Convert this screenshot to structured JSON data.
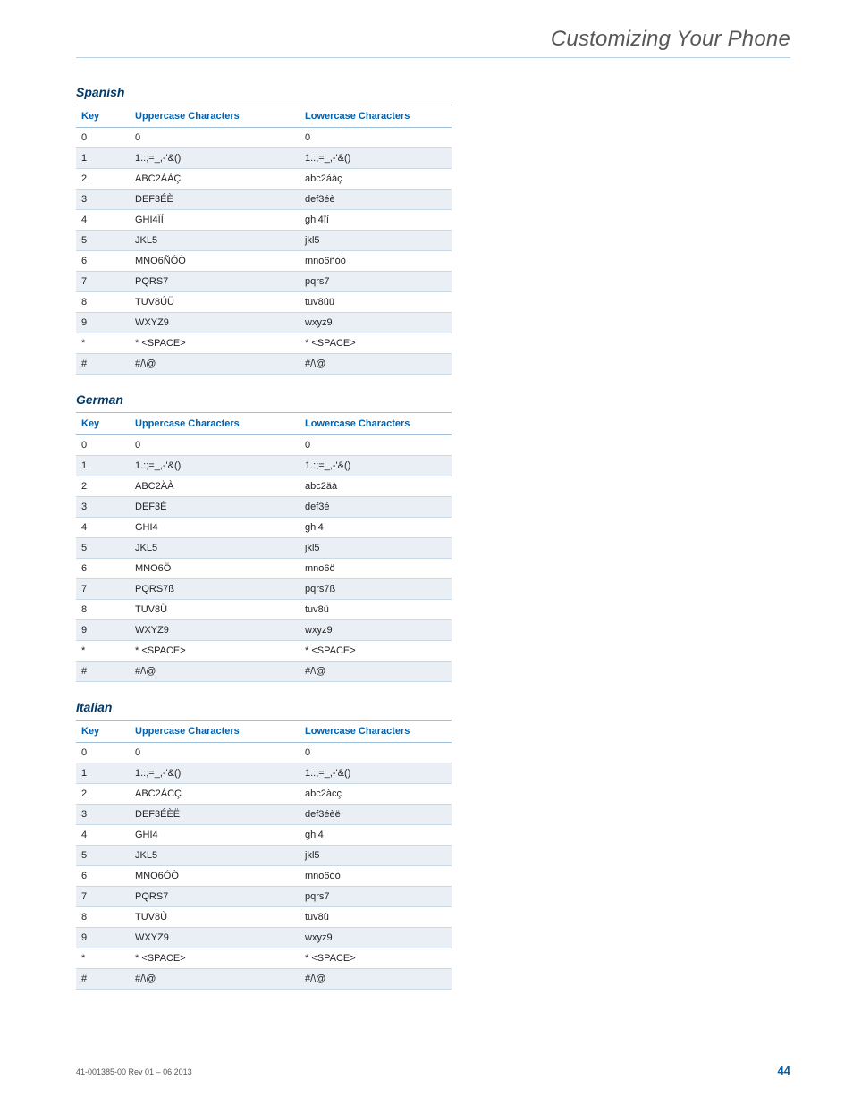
{
  "header": {
    "title": "Customizing Your Phone"
  },
  "columns": {
    "key": "Key",
    "upper": "Uppercase Characters",
    "lower": "Lowercase Characters"
  },
  "sections": [
    {
      "title": "Spanish",
      "rows": [
        {
          "key": "0",
          "upper": "0",
          "lower": "0"
        },
        {
          "key": "1",
          "upper": "1.:;=_,-'&()",
          "lower": "1.:;=_,-'&()"
        },
        {
          "key": "2",
          "upper": "ABC2ÁÀÇ",
          "lower": "abc2áàç"
        },
        {
          "key": "3",
          "upper": "DEF3ÉÈ",
          "lower": "def3éè"
        },
        {
          "key": "4",
          "upper": "GHI4ÏÍ",
          "lower": "ghi4ïí"
        },
        {
          "key": "5",
          "upper": "JKL5",
          "lower": "jkl5"
        },
        {
          "key": "6",
          "upper": "MNO6ÑÓÒ",
          "lower": "mno6ñóò"
        },
        {
          "key": "7",
          "upper": "PQRS7",
          "lower": "pqrs7"
        },
        {
          "key": "8",
          "upper": "TUV8ÚÜ",
          "lower": "tuv8úü"
        },
        {
          "key": "9",
          "upper": "WXYZ9",
          "lower": "wxyz9"
        },
        {
          "key": "*",
          "upper": "* <SPACE>",
          "lower": "* <SPACE>"
        },
        {
          "key": "#",
          "upper": "#/\\@",
          "lower": "#/\\@"
        }
      ]
    },
    {
      "title": "German",
      "rows": [
        {
          "key": "0",
          "upper": "0",
          "lower": "0"
        },
        {
          "key": "1",
          "upper": "1.:;=_,-'&()",
          "lower": "1.:;=_,-'&()"
        },
        {
          "key": "2",
          "upper": "ABC2ÄÀ",
          "lower": "abc2äà"
        },
        {
          "key": "3",
          "upper": "DEF3É",
          "lower": "def3é"
        },
        {
          "key": "4",
          "upper": "GHI4",
          "lower": "ghi4"
        },
        {
          "key": "5",
          "upper": "JKL5",
          "lower": "jkl5"
        },
        {
          "key": "6",
          "upper": "MNO6Ö",
          "lower": "mno6ö"
        },
        {
          "key": "7",
          "upper": "PQRS7ß",
          "lower": "pqrs7ß"
        },
        {
          "key": "8",
          "upper": "TUV8Ü",
          "lower": "tuv8ü"
        },
        {
          "key": "9",
          "upper": "WXYZ9",
          "lower": "wxyz9"
        },
        {
          "key": "*",
          "upper": "* <SPACE>",
          "lower": "* <SPACE>"
        },
        {
          "key": "#",
          "upper": "#/\\@",
          "lower": "#/\\@"
        }
      ]
    },
    {
      "title": "Italian",
      "rows": [
        {
          "key": "0",
          "upper": "0",
          "lower": "0"
        },
        {
          "key": "1",
          "upper": "1.:;=_,-'&()",
          "lower": "1.:;=_,-'&()"
        },
        {
          "key": "2",
          "upper": "ABC2ÀCÇ",
          "lower": "abc2àcç"
        },
        {
          "key": "3",
          "upper": "DEF3ÉÈË",
          "lower": "def3éèë"
        },
        {
          "key": "4",
          "upper": "GHI4",
          "lower": "ghi4"
        },
        {
          "key": "5",
          "upper": "JKL5",
          "lower": "jkl5"
        },
        {
          "key": "6",
          "upper": "MNO6ÓÒ",
          "lower": "mno6óò"
        },
        {
          "key": "7",
          "upper": "PQRS7",
          "lower": "pqrs7"
        },
        {
          "key": "8",
          "upper": "TUV8Ù",
          "lower": "tuv8ù"
        },
        {
          "key": "9",
          "upper": "WXYZ9",
          "lower": "wxyz9"
        },
        {
          "key": "*",
          "upper": "* <SPACE>",
          "lower": "* <SPACE>"
        },
        {
          "key": "#",
          "upper": "#/\\@",
          "lower": "#/\\@"
        }
      ]
    }
  ],
  "footer": {
    "left": "41-001385-00 Rev 01 – 06.2013",
    "page": "44"
  }
}
